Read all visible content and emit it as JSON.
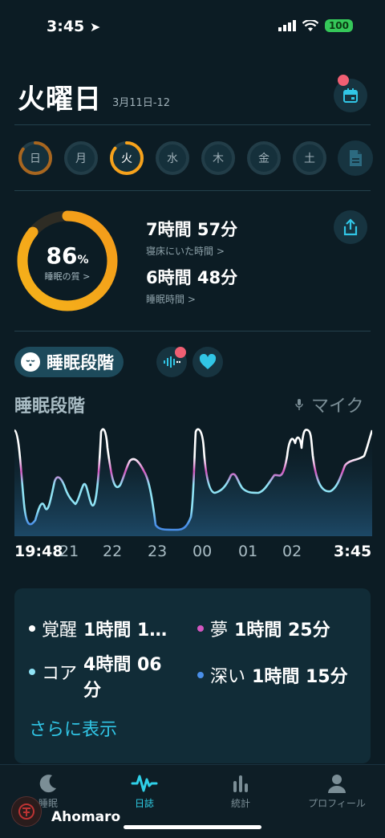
{
  "status": {
    "time": "3:45",
    "battery": "100"
  },
  "header": {
    "day": "火曜日",
    "date_range": "3月11日-12"
  },
  "week": {
    "days": [
      {
        "label": "日",
        "ring_color": "#a8661f",
        "fill": 0.85
      },
      {
        "label": "月",
        "ring_color": "",
        "fill": 0
      },
      {
        "label": "火",
        "ring_color": "#f7a21b",
        "fill": 0.86,
        "selected": true
      },
      {
        "label": "水",
        "ring_color": "",
        "fill": 0
      },
      {
        "label": "木",
        "ring_color": "",
        "fill": 0
      },
      {
        "label": "金",
        "ring_color": "",
        "fill": 0
      },
      {
        "label": "土",
        "ring_color": "",
        "fill": 0
      }
    ]
  },
  "summary": {
    "score": "86",
    "score_unit": "%",
    "score_label": "睡眠の質 >",
    "score_fraction": 0.86,
    "time_in_bed": "7時間 57分",
    "time_in_bed_label": "寝床にいた時間 >",
    "sleep_time": "6時間 48分",
    "sleep_time_label": "睡眠時間 >"
  },
  "section": {
    "pill_label": "睡眠段階",
    "chart_title": "睡眠段階",
    "mic_label": "マイク"
  },
  "chart_data": {
    "type": "line",
    "title": "睡眠段階",
    "x_ticks": [
      "19:48",
      "21",
      "22",
      "23",
      "00",
      "01",
      "02",
      "3:45"
    ],
    "y_levels": [
      "覚醒",
      "夢",
      "コア",
      "深い"
    ],
    "colors": {
      "awake": "#ffffff",
      "rem": "#d357c0",
      "core": "#8fe3f5",
      "deep": "#4a8fe8"
    }
  },
  "legend": {
    "awake_label": "覚醒",
    "awake_value": "1時間 1…",
    "rem_label": "夢",
    "rem_value": "1時間 25分",
    "core_label": "コア",
    "core_value": "4時間 06分",
    "deep_label": "深い",
    "deep_value": "1時間 15分",
    "more_link": "さらに表示"
  },
  "tabs": [
    {
      "label": "睡眠",
      "icon": "moon-icon"
    },
    {
      "label": "日誌",
      "icon": "wave-icon",
      "active": true
    },
    {
      "label": "統計",
      "icon": "bar-chart-icon"
    },
    {
      "label": "プロフィール",
      "icon": "person-icon"
    }
  ],
  "watermark": {
    "user": "Ahomaro"
  }
}
